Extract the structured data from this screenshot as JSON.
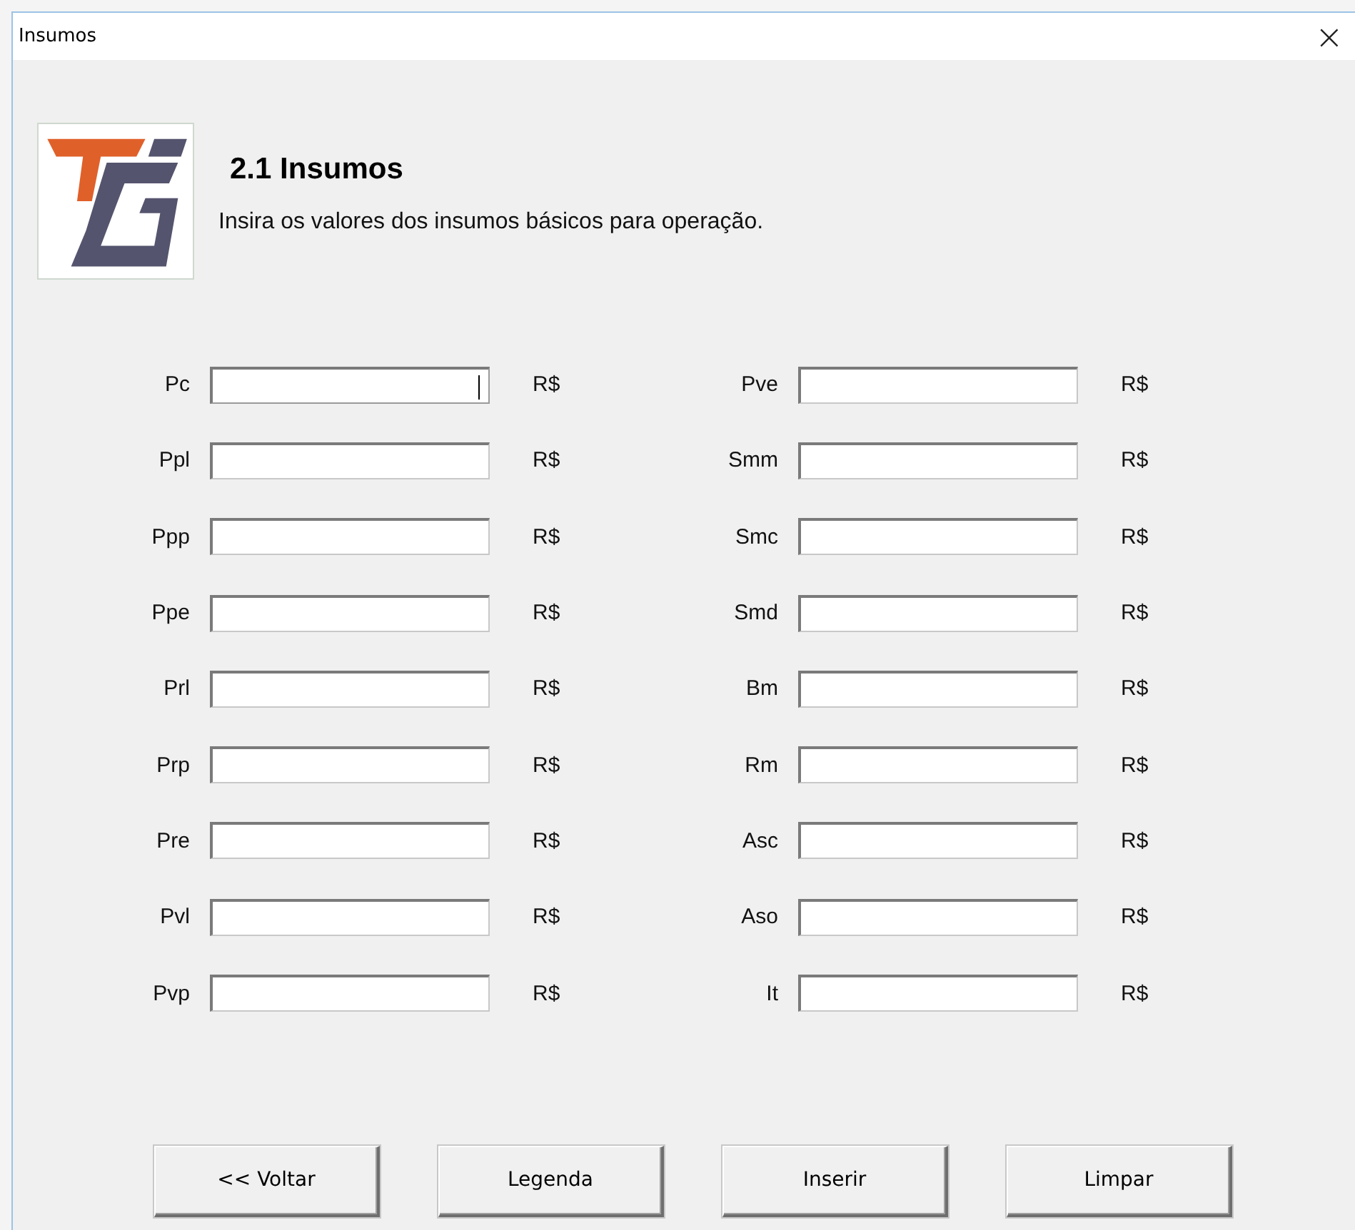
{
  "window": {
    "title": "Insumos",
    "close": "×"
  },
  "header": {
    "title": "2.1 Insumos",
    "subtitle": "Insira os valores dos insumos básicos para operação."
  },
  "fields": [
    {
      "label": "Pc",
      "unit": "R$",
      "focused": true
    },
    {
      "label": "Pve",
      "unit": "R$",
      "focused": false
    },
    {
      "label": "Ppl",
      "unit": "R$",
      "focused": false
    },
    {
      "label": "Smm",
      "unit": "R$",
      "focused": false
    },
    {
      "label": "Ppp",
      "unit": "R$",
      "focused": false
    },
    {
      "label": "Smc",
      "unit": "R$",
      "focused": false
    },
    {
      "label": "Ppe",
      "unit": "R$",
      "focused": false
    },
    {
      "label": "Smd",
      "unit": "R$",
      "focused": false
    },
    {
      "label": "Prl",
      "unit": "R$",
      "focused": false
    },
    {
      "label": "Bm",
      "unit": "R$",
      "focused": false
    },
    {
      "label": "Prp",
      "unit": "R$",
      "focused": false
    },
    {
      "label": "Rm",
      "unit": "R$",
      "focused": false
    },
    {
      "label": "Pre",
      "unit": "R$",
      "focused": false
    },
    {
      "label": "Asc",
      "unit": "R$",
      "focused": false
    },
    {
      "label": "Pvl",
      "unit": "R$",
      "focused": false
    },
    {
      "label": "Aso",
      "unit": "R$",
      "focused": false
    },
    {
      "label": "Pvp",
      "unit": "R$",
      "focused": false
    },
    {
      "label": "It",
      "unit": "R$",
      "focused": false
    }
  ],
  "buttons": [
    "<< Voltar",
    "Legenda",
    "Inserir",
    "Limpar"
  ]
}
